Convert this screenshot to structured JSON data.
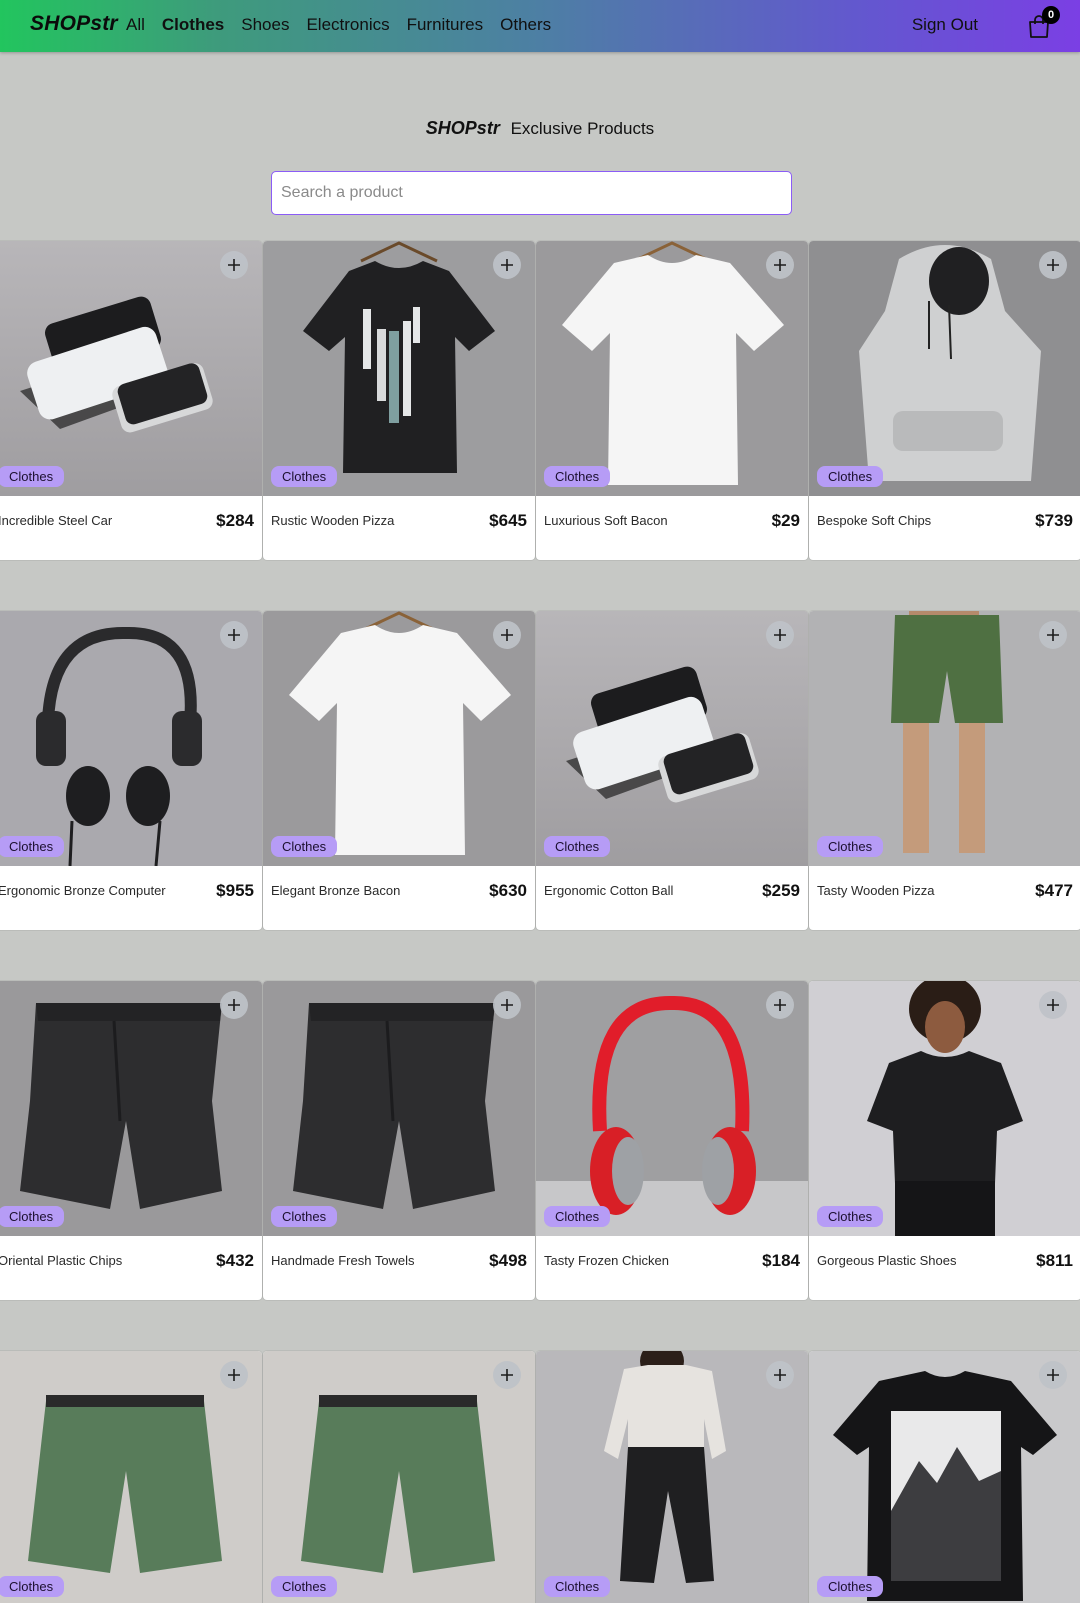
{
  "nav": {
    "brand": "SHOPstr",
    "links": [
      "All",
      "Clothes",
      "Shoes",
      "Electronics",
      "Furnitures",
      "Others"
    ],
    "active": "Clothes",
    "signout": "Sign Out",
    "cart_count": "0"
  },
  "hero": {
    "brand": "SHOPstr",
    "subtitle": "Exclusive Products"
  },
  "search": {
    "placeholder": "Search a product",
    "value": ""
  },
  "products": [
    {
      "name": "Incredible Steel Car",
      "price": "$284",
      "category": "Clothes",
      "image": "phone-cases"
    },
    {
      "name": "Rustic Wooden Pizza",
      "price": "$645",
      "category": "Clothes",
      "image": "black-tshirt"
    },
    {
      "name": "Luxurious Soft Bacon",
      "price": "$29",
      "category": "Clothes",
      "image": "white-tshirt"
    },
    {
      "name": "Bespoke Soft Chips",
      "price": "$739",
      "category": "Clothes",
      "image": "grey-hoodie"
    },
    {
      "name": "Ergonomic Bronze Computer",
      "price": "$955",
      "category": "Clothes",
      "image": "black-headphones"
    },
    {
      "name": "Elegant Bronze Bacon",
      "price": "$630",
      "category": "Clothes",
      "image": "white-tshirt"
    },
    {
      "name": "Ergonomic Cotton Ball",
      "price": "$259",
      "category": "Clothes",
      "image": "phone-cases"
    },
    {
      "name": "Tasty Wooden Pizza",
      "price": "$477",
      "category": "Clothes",
      "image": "green-shorts-model"
    },
    {
      "name": "Oriental Plastic Chips",
      "price": "$432",
      "category": "Clothes",
      "image": "black-shorts"
    },
    {
      "name": "Handmade Fresh Towels",
      "price": "$498",
      "category": "Clothes",
      "image": "black-shorts"
    },
    {
      "name": "Tasty Frozen Chicken",
      "price": "$184",
      "category": "Clothes",
      "image": "red-headphones"
    },
    {
      "name": "Gorgeous Plastic Shoes",
      "price": "$811",
      "category": "Clothes",
      "image": "woman-tshirt"
    },
    {
      "name": "",
      "price": "",
      "category": "Clothes",
      "image": "green-shorts"
    },
    {
      "name": "",
      "price": "",
      "category": "Clothes",
      "image": "green-shorts"
    },
    {
      "name": "",
      "price": "",
      "category": "Clothes",
      "image": "woman-joggers"
    },
    {
      "name": "",
      "price": "",
      "category": "Clothes",
      "image": "mountain-tshirt"
    }
  ],
  "colors": {
    "accent": "#8b5cf6",
    "badge": "#b69cf6",
    "nav_start": "#22c55e",
    "nav_end": "#7b3fe4"
  }
}
